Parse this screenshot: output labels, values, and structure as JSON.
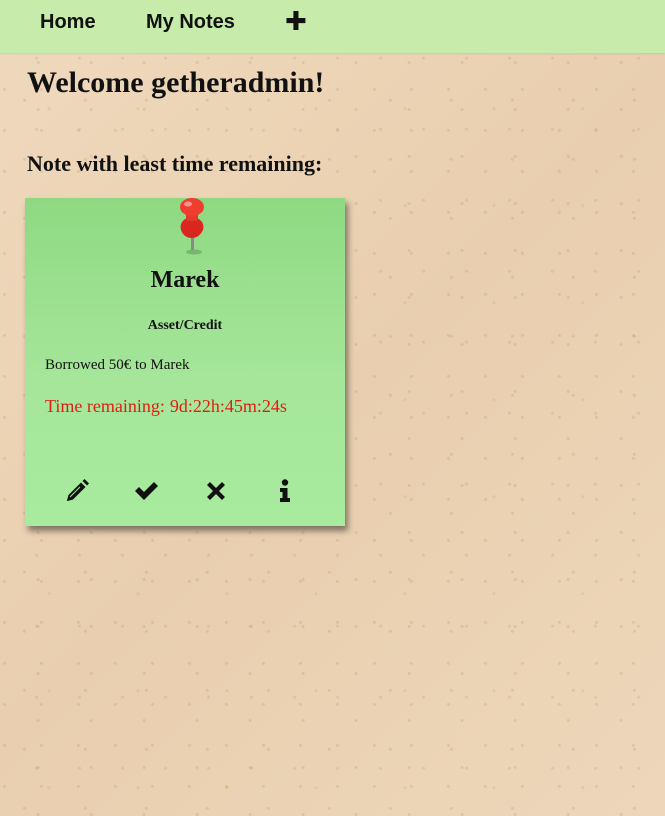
{
  "nav": {
    "home_label": "Home",
    "notes_label": "My Notes",
    "add_label": "✚"
  },
  "welcome": {
    "greeting": "Welcome getheradmin!"
  },
  "section": {
    "heading": "Note with least time remaining:"
  },
  "note": {
    "title": "Marek",
    "category": "Asset/Credit",
    "body": "Borrowed 50€ to Marek",
    "timer_label": "Time remaining:",
    "timer_value": "9d:22h:45m:24s",
    "color": "#a5e69a",
    "timer_color": "#e11d10",
    "actions": [
      {
        "icon": "pencil-icon"
      },
      {
        "icon": "check-icon"
      },
      {
        "icon": "x-icon"
      },
      {
        "icon": "info-icon"
      }
    ]
  },
  "colors": {
    "navbar": "#c7ebab",
    "background": "#ecd4b6",
    "pin": "#e8322a"
  }
}
